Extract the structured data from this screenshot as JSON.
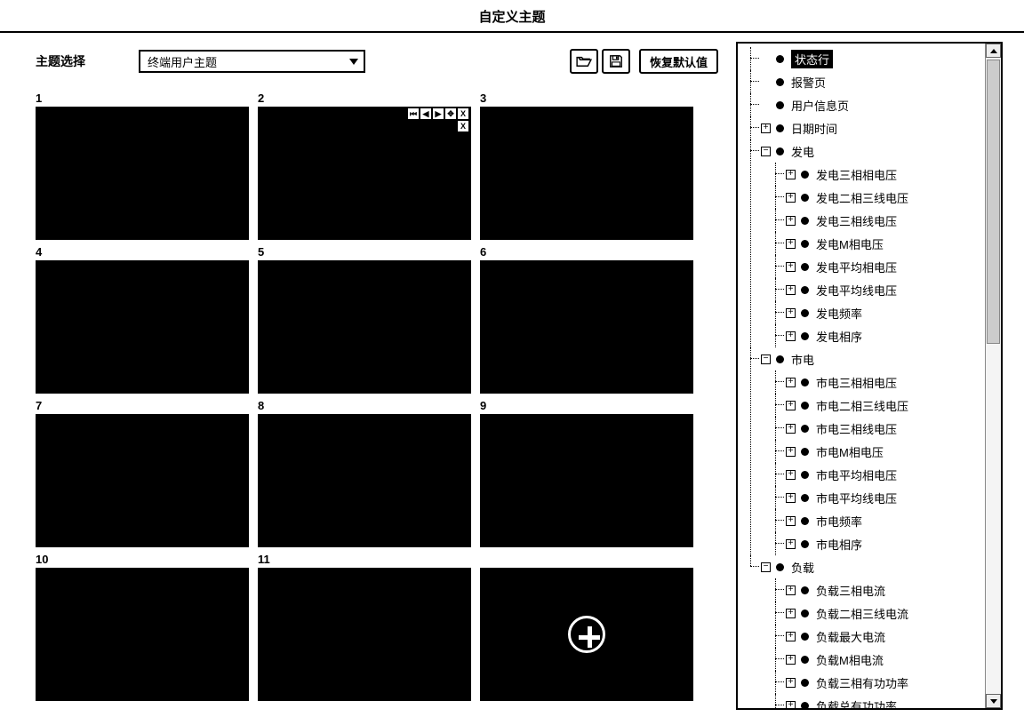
{
  "title": "自定义主题",
  "theme_selector": {
    "label": "主题选择",
    "value": "终端用户主题"
  },
  "buttons": {
    "restore_default": "恢复默认值"
  },
  "slots": [
    "1",
    "2",
    "3",
    "4",
    "5",
    "6",
    "7",
    "8",
    "9",
    "10",
    "11"
  ],
  "tree": [
    {
      "label": "状态行",
      "expand": "none",
      "selected": true
    },
    {
      "label": "报警页",
      "expand": "none"
    },
    {
      "label": "用户信息页",
      "expand": "none"
    },
    {
      "label": "日期时间",
      "expand": "plus"
    },
    {
      "label": "发电",
      "expand": "minus",
      "children": [
        {
          "label": "发电三相相电压",
          "expand": "plus"
        },
        {
          "label": "发电二相三线电压",
          "expand": "plus"
        },
        {
          "label": "发电三相线电压",
          "expand": "plus"
        },
        {
          "label": "发电M相电压",
          "expand": "plus"
        },
        {
          "label": "发电平均相电压",
          "expand": "plus"
        },
        {
          "label": "发电平均线电压",
          "expand": "plus"
        },
        {
          "label": "发电频率",
          "expand": "plus"
        },
        {
          "label": "发电相序",
          "expand": "plus"
        }
      ]
    },
    {
      "label": "市电",
      "expand": "minus",
      "children": [
        {
          "label": "市电三相相电压",
          "expand": "plus"
        },
        {
          "label": "市电二相三线电压",
          "expand": "plus"
        },
        {
          "label": "市电三相线电压",
          "expand": "plus"
        },
        {
          "label": "市电M相电压",
          "expand": "plus"
        },
        {
          "label": "市电平均相电压",
          "expand": "plus"
        },
        {
          "label": "市电平均线电压",
          "expand": "plus"
        },
        {
          "label": "市电频率",
          "expand": "plus"
        },
        {
          "label": "市电相序",
          "expand": "plus"
        }
      ]
    },
    {
      "label": "负载",
      "expand": "minus",
      "children": [
        {
          "label": "负载三相电流",
          "expand": "plus"
        },
        {
          "label": "负载二相三线电流",
          "expand": "plus"
        },
        {
          "label": "负载最大电流",
          "expand": "plus"
        },
        {
          "label": "负载M相电流",
          "expand": "plus"
        },
        {
          "label": "负载三相有功功率",
          "expand": "plus"
        },
        {
          "label": "负载总有功功率",
          "expand": "plus"
        }
      ]
    }
  ]
}
